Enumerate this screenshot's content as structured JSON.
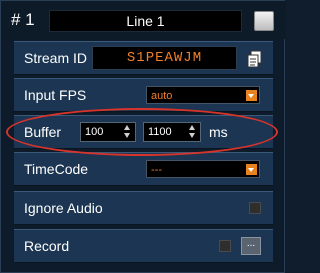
{
  "header": {
    "number": "# 1",
    "title": "Line 1"
  },
  "stream_id": {
    "label": "Stream ID",
    "value": "S1PEAWJM"
  },
  "input_fps": {
    "label": "Input FPS",
    "selected": "auto"
  },
  "buffer": {
    "label": "Buffer",
    "min_value": "100",
    "max_value": "1100",
    "unit": "ms"
  },
  "timecode": {
    "label": "TimeCode",
    "selected": "---"
  },
  "ignore_audio": {
    "label": "Ignore Audio"
  },
  "record": {
    "label": "Record",
    "more_label": "..."
  },
  "colors": {
    "accent": "#f07e2a",
    "row_bg": "#1b3552",
    "panel_bg": "#0d1b2a",
    "highlight": "#d9342b"
  }
}
